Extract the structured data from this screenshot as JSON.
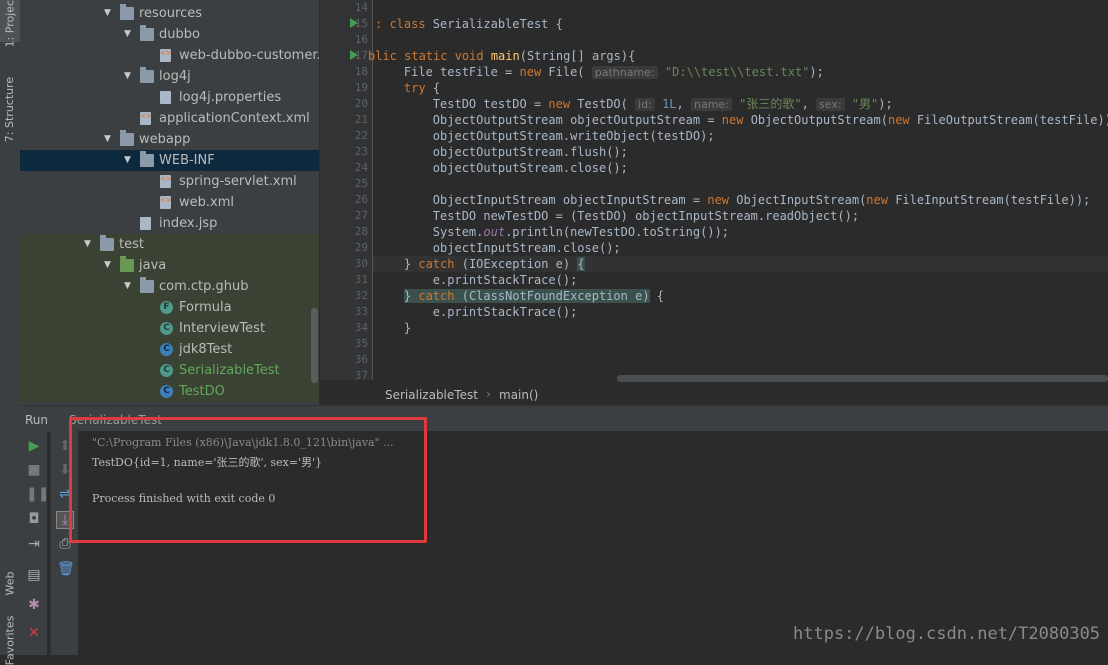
{
  "left_strip": {
    "tabs": [
      "1: Project",
      "7: Structure",
      "Web",
      "Favorites"
    ]
  },
  "project_tree": {
    "items": [
      {
        "label": "resources",
        "kind": "folder",
        "indent": 1,
        "expanded": true
      },
      {
        "label": "dubbo",
        "kind": "folder",
        "indent": 2,
        "expanded": true
      },
      {
        "label": "web-dubbo-customer.xml",
        "kind": "xml",
        "indent": 3
      },
      {
        "label": "log4j",
        "kind": "folder",
        "indent": 2,
        "expanded": true
      },
      {
        "label": "log4j.properties",
        "kind": "file",
        "indent": 3
      },
      {
        "label": "applicationContext.xml",
        "kind": "xml",
        "indent": 2
      },
      {
        "label": "webapp",
        "kind": "folder",
        "indent": 1,
        "expanded": true
      },
      {
        "label": "WEB-INF",
        "kind": "folder",
        "indent": 2,
        "expanded": true,
        "selected": true
      },
      {
        "label": "spring-servlet.xml",
        "kind": "xml",
        "indent": 3
      },
      {
        "label": "web.xml",
        "kind": "xml",
        "indent": 3
      },
      {
        "label": "index.jsp",
        "kind": "file",
        "indent": 2
      },
      {
        "label": "test",
        "kind": "folder",
        "indent": 0,
        "expanded": true
      },
      {
        "label": "java",
        "kind": "srcfolder",
        "indent": 1,
        "expanded": true
      },
      {
        "label": "com.ctp.ghub",
        "kind": "folder",
        "indent": 2,
        "expanded": true
      },
      {
        "label": "Formula",
        "kind": "class",
        "indent": 3
      },
      {
        "label": "InterviewTest",
        "kind": "class",
        "indent": 3
      },
      {
        "label": "jdk8Test",
        "kind": "classblue",
        "indent": 3
      },
      {
        "label": "SerializableTest",
        "kind": "class",
        "indent": 3,
        "green_text": true
      },
      {
        "label": "TestDO",
        "kind": "classblue",
        "indent": 3,
        "green_text": true
      }
    ]
  },
  "editor": {
    "line_numbers": [
      "14",
      "15",
      "16",
      "17",
      "18",
      "19",
      "20",
      "21",
      "22",
      "23",
      "24",
      "25",
      "26",
      "27",
      "28",
      "29",
      "30",
      "31",
      "32",
      "33",
      "34",
      "35",
      "36",
      "37"
    ],
    "breadcrumb": {
      "class": "SerializableTest",
      "method": "main()"
    }
  },
  "run_panel": {
    "title": "Run",
    "tab": "SerializableTest"
  },
  "console": {
    "lines": [
      "\"C:\\Program Files (x86)\\Java\\jdk1.8.0_121\\bin\\java\" ...",
      "TestDO{id=1, name='张三的歌', sex='男'}",
      "",
      "Process finished with exit code 0"
    ]
  },
  "watermark": "https://blog.csdn.net/T2080305",
  "colors": {
    "accent_red": "#e0393e",
    "run_green": "#499c54",
    "keyword": "#cc7832"
  }
}
